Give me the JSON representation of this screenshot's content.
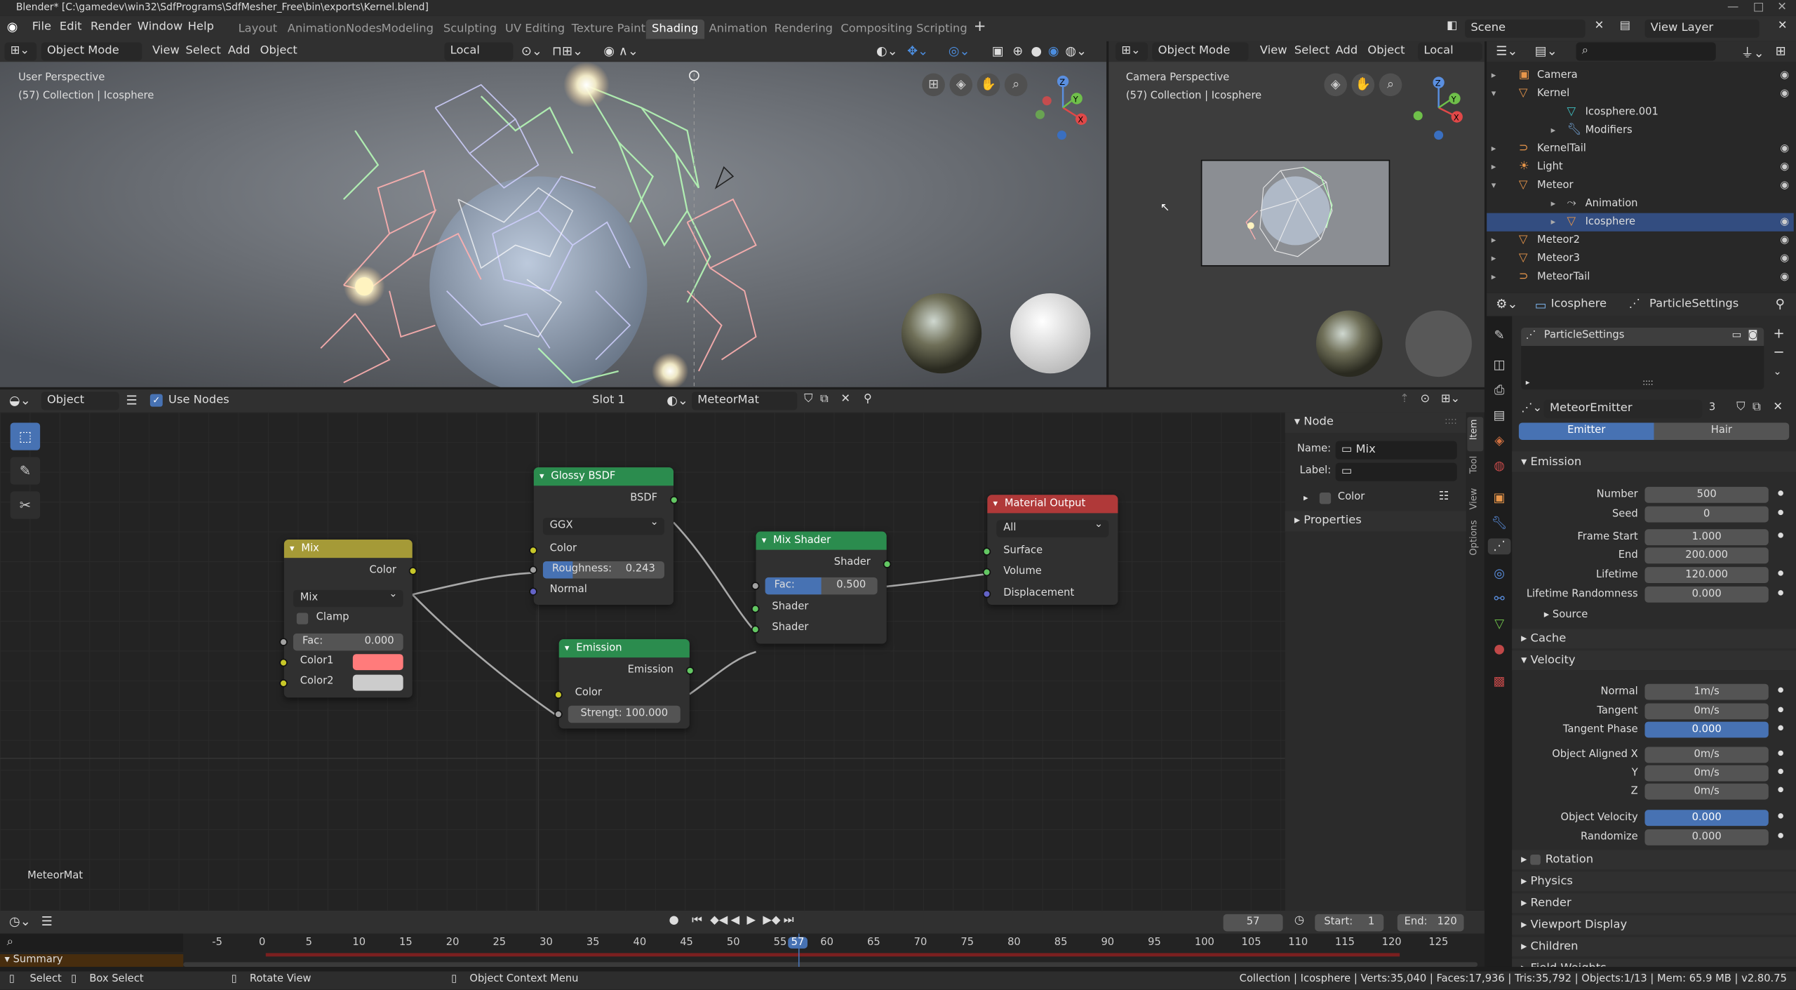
{
  "window": {
    "title": "Blender* [C:\\gamedev\\win32\\SdfPrograms\\SdfMesher_Free\\bin\\exports\\Kernel.blend]"
  },
  "menus": [
    "File",
    "Edit",
    "Render",
    "Window",
    "Help"
  ],
  "workspaces": [
    "Layout",
    "AnimationNodes",
    "Modeling",
    "Sculpting",
    "UV Editing",
    "Texture Paint",
    "Shading",
    "Animation",
    "Rendering",
    "Compositing",
    "Scripting"
  ],
  "scene": "Scene",
  "view_layer": "View Layer",
  "viewport_left": {
    "mode": "Object Mode",
    "menus": [
      "View",
      "Select",
      "Add",
      "Object"
    ],
    "orientation": "Local",
    "perspective": "User Perspective",
    "info": "(57) Collection | Icosphere"
  },
  "viewport_right": {
    "mode": "Object Mode",
    "menus": [
      "View",
      "Select",
      "Add",
      "Object"
    ],
    "orientation": "Local",
    "perspective": "Camera Perspective",
    "info": "(57) Collection | Icosphere"
  },
  "outliner": {
    "items": [
      {
        "label": "Camera",
        "indent": 0,
        "icon": "camera-icon",
        "color": "#e8964a"
      },
      {
        "label": "Kernel",
        "indent": 0,
        "icon": "object-icon",
        "color": "#e8964a",
        "expanded": true
      },
      {
        "label": "Icosphere.001",
        "indent": 1,
        "icon": "mesh-icon",
        "color": "#3fc1c4"
      },
      {
        "label": "Modifiers",
        "indent": 1,
        "icon": "wrench-icon",
        "color": "#7ab0e8"
      },
      {
        "label": "KernelTail",
        "indent": 0,
        "icon": "curve-icon",
        "color": "#e8964a"
      },
      {
        "label": "Light",
        "indent": 0,
        "icon": "light-icon",
        "color": "#e8964a"
      },
      {
        "label": "Meteor",
        "indent": 0,
        "icon": "object-icon",
        "color": "#e8964a",
        "expanded": true
      },
      {
        "label": "Animation",
        "indent": 1,
        "icon": "anim-icon",
        "color": "#ccc"
      },
      {
        "label": "Icosphere",
        "indent": 1,
        "icon": "mesh-icon",
        "color": "#e8964a",
        "selected": true
      },
      {
        "label": "Meteor2",
        "indent": 0,
        "icon": "object-icon",
        "color": "#e8964a"
      },
      {
        "label": "Meteor3",
        "indent": 0,
        "icon": "object-icon",
        "color": "#e8964a"
      },
      {
        "label": "MeteorTail",
        "indent": 0,
        "icon": "curve-icon",
        "color": "#e8964a"
      }
    ]
  },
  "node_editor": {
    "object": "Object",
    "use_nodes": "Use Nodes",
    "slot": "Slot 1",
    "material": "MeteorMat",
    "footer": "MeteorMat",
    "mix": {
      "title": "Mix",
      "out": "Color",
      "mode": "Mix",
      "clamp": "Clamp",
      "fac_label": "Fac:",
      "fac": "0.000",
      "c1": "Color1",
      "c2": "Color2",
      "c1_color": "#ff7b7b",
      "c2_color": "#cccccc"
    },
    "glossy": {
      "title": "Glossy BSDF",
      "out": "BSDF",
      "dist": "GGX",
      "color": "Color",
      "rough_label": "Roughness:",
      "rough": "0.243",
      "rough_fill": 0.243,
      "normal": "Normal"
    },
    "emission": {
      "title": "Emission",
      "out": "Emission",
      "color": "Color",
      "str_label": "Strengt:",
      "str": "100.000"
    },
    "mixshader": {
      "title": "Mix Shader",
      "out": "Shader",
      "fac_label": "Fac:",
      "fac": "0.500",
      "fac_fill": 0.5,
      "s1": "Shader",
      "s2": "Shader"
    },
    "output": {
      "title": "Material Output",
      "target": "All",
      "surface": "Surface",
      "volume": "Volume",
      "disp": "Displacement"
    },
    "sidebar": {
      "header": "Node",
      "name_label": "Name:",
      "name": "Mix",
      "label_label": "Label:",
      "color": "Color",
      "props": "Properties",
      "tabs": [
        "Item",
        "Tool",
        "View",
        "Options"
      ]
    }
  },
  "properties": {
    "crumb1": "Icosphere",
    "crumb2": "ParticleSettings",
    "slot": "ParticleSettings",
    "settings": "MeteorEmitter",
    "users": "3",
    "tab_emitter": "Emitter",
    "tab_hair": "Hair",
    "emission": {
      "title": "Emission",
      "rows": [
        [
          "Number",
          "500"
        ],
        [
          "Seed",
          "0"
        ],
        [
          "Frame Start",
          "1.000"
        ],
        [
          "End",
          "200.000"
        ],
        [
          "Lifetime",
          "120.000"
        ],
        [
          "Lifetime Randomness",
          "0.000"
        ]
      ]
    },
    "source": "Source",
    "cache": "Cache",
    "velocity": {
      "title": "Velocity",
      "rows": [
        [
          "Normal",
          "1m/s"
        ],
        [
          "Tangent",
          "0m/s"
        ],
        [
          "Tangent Phase",
          "0.000"
        ],
        [
          "Object Aligned X",
          "0m/s"
        ],
        [
          "Y",
          "0m/s"
        ],
        [
          "Z",
          "0m/s"
        ],
        [
          "Object Velocity",
          "0.000"
        ],
        [
          "Randomize",
          "0.000"
        ]
      ]
    },
    "collapsed": [
      "Rotation",
      "Physics",
      "Render",
      "Viewport Display",
      "Children",
      "Field Weights"
    ]
  },
  "timeline": {
    "frame": "57",
    "start_label": "Start:",
    "start": "1",
    "end_label": "End:",
    "end": "120",
    "ticks": [
      "-5",
      "0",
      "5",
      "10",
      "15",
      "20",
      "25",
      "30",
      "35",
      "40",
      "45",
      "50",
      "55",
      "57",
      "60",
      "65",
      "70",
      "75",
      "80",
      "85",
      "90",
      "95",
      "100",
      "105",
      "110",
      "115",
      "120",
      "125"
    ],
    "summary": "Summary"
  },
  "statusbar": {
    "select": "Select",
    "box": "Box Select",
    "rotate": "Rotate View",
    "ctx": "Object Context Menu",
    "stats": "Collection | Icosphere | Verts:35,040 | Faces:17,936 | Tris:35,792 | Objects:1/13 | Mem: 65.9 MB | v2.80.75"
  }
}
